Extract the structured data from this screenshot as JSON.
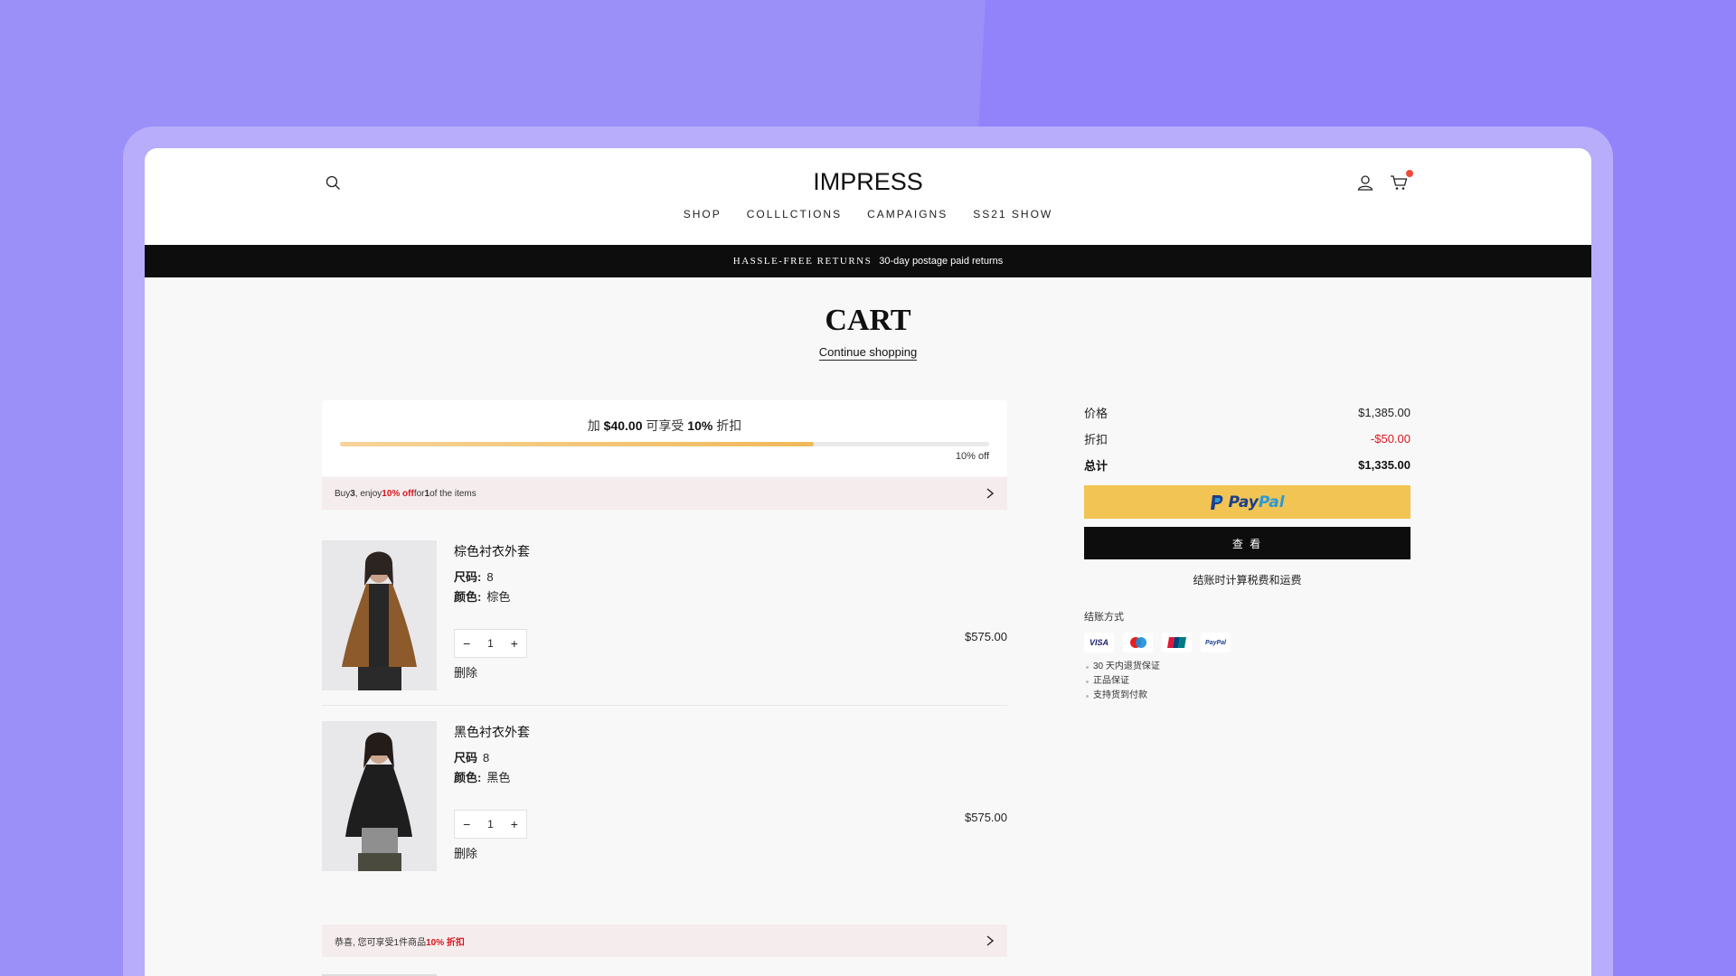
{
  "brand": {
    "logo": "IMPRESS"
  },
  "nav": [
    "SHOP",
    "COLLLCTIONS",
    "CAMPAIGNS",
    "SS21 SHOW"
  ],
  "announcement": {
    "strong": "HASSLE-FREE RETURNS",
    "text": "30-day postage paid returns"
  },
  "page": {
    "title": "CART",
    "continue_link": "Continue shopping"
  },
  "promo": {
    "prefix": "加 ",
    "amount": "$40.00",
    "middle": " 可享受 ",
    "discount": "10%",
    "suffix": " 折扣",
    "progress_percent": 73,
    "progress_label": "10% off"
  },
  "offer_top": {
    "text_before_qty": "Buy ",
    "qty": "3",
    "text_mid": ", enjoy ",
    "discount": "10% off",
    "text_for": " for ",
    "count": "1",
    "text_after": " of the items"
  },
  "items": [
    {
      "name": "棕色衬衣外套",
      "size_label": "尺码:",
      "size": "8",
      "color_label": "颜色:",
      "color": "棕色",
      "qty": "1",
      "minus": "−",
      "plus": "+",
      "remove": "删除",
      "price": "$575.00"
    },
    {
      "name": "黑色衬衣外套",
      "size_label": "尺码",
      "size": "8",
      "color_label": "颜色:",
      "color": "黑色",
      "qty": "1",
      "minus": "−",
      "plus": "+",
      "remove": "删除",
      "price": "$575.00"
    }
  ],
  "offer_bottom": {
    "text": "恭喜, 您可享受1件商品",
    "discount": "10% 折扣"
  },
  "summary": {
    "price_label": "价格",
    "price": "$1,385.00",
    "discount_label": "折扣",
    "discount": "-$50.00",
    "total_label": "总计",
    "total": "$1,335.00",
    "paypal_part1": "Pay",
    "paypal_part2": "Pal",
    "checkout": "查 看",
    "tax_note": "结账时计算税费和运费",
    "payment_title": "结账方式",
    "payment_methods": [
      "VISA",
      "Maestro",
      "UnionPay",
      "PayPal"
    ],
    "assurances": [
      "30 天内退货保证",
      "正品保证",
      "支持货到付款"
    ]
  },
  "colors": {
    "accent_red": "#d9151d",
    "paypal_yellow": "#f2c453",
    "progress": "#f0b95a",
    "badge": "#ef4b3a"
  }
}
